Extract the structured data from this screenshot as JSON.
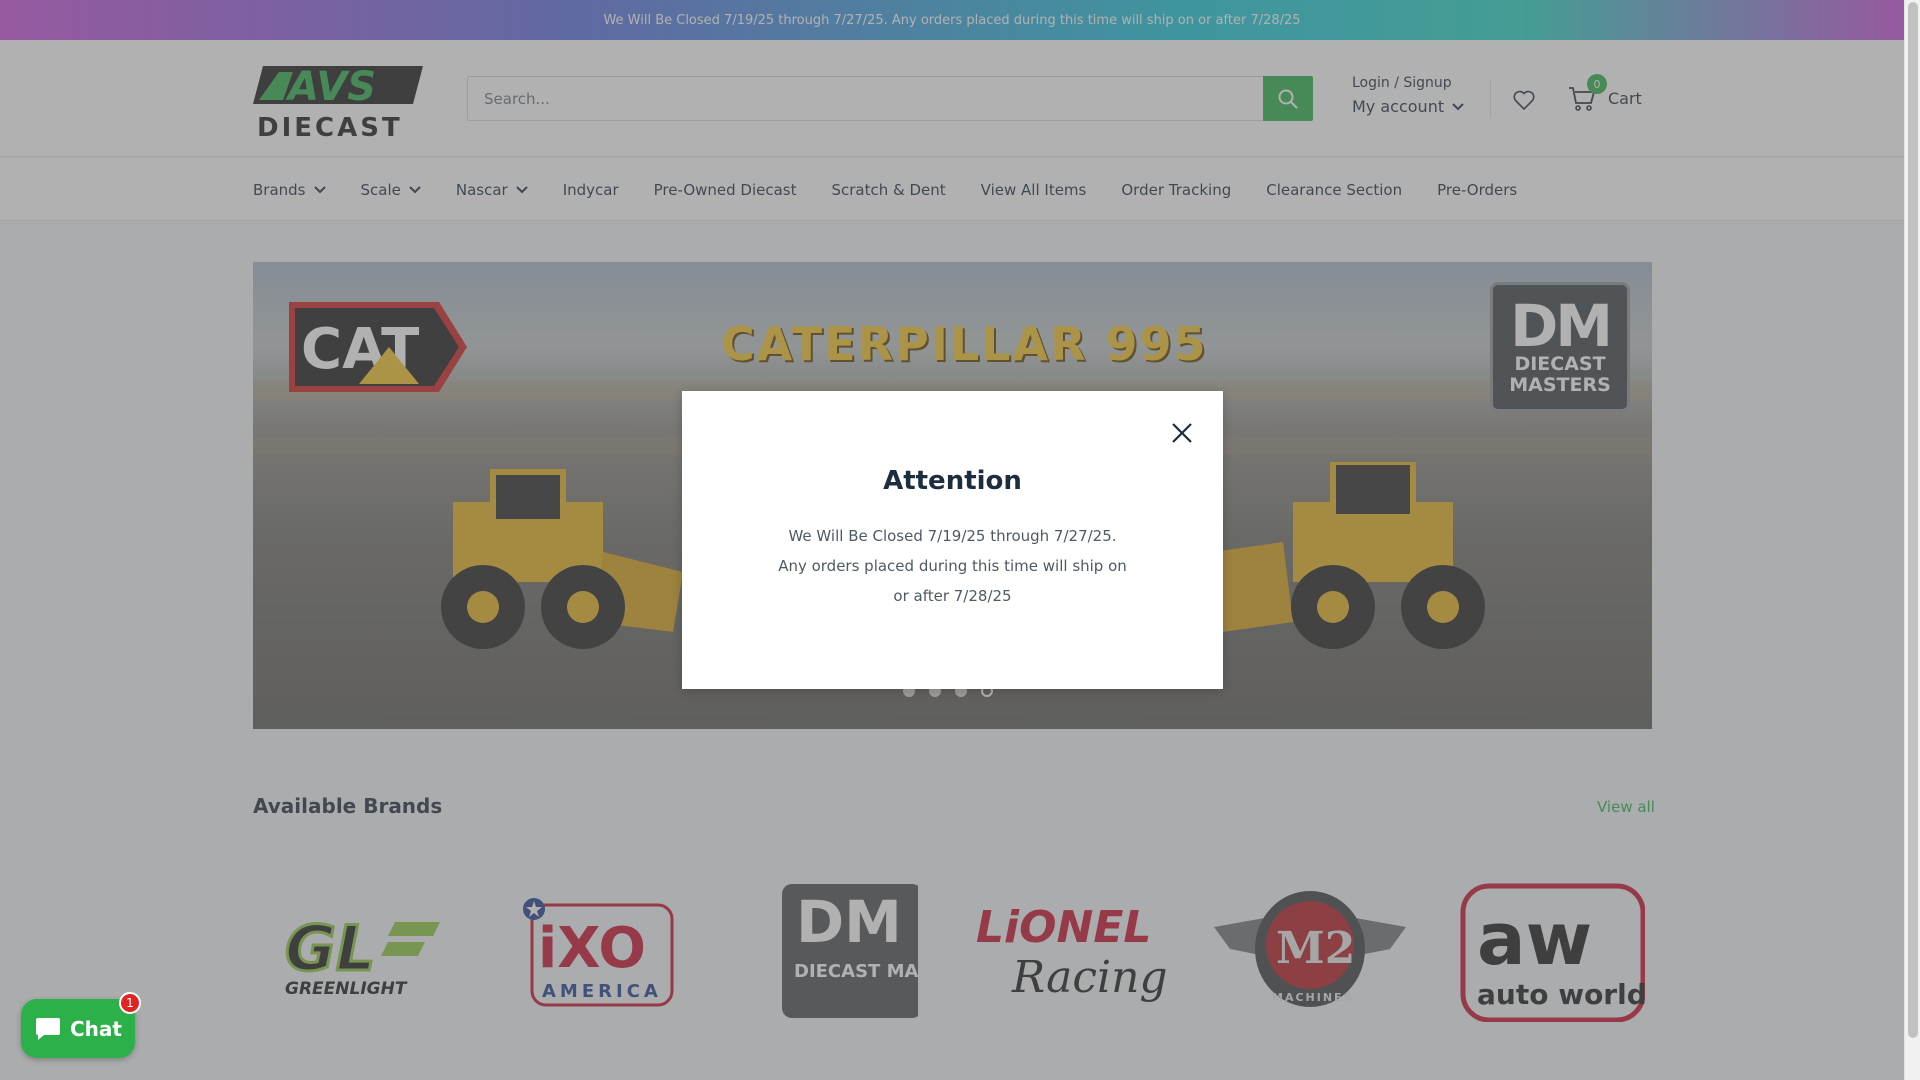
{
  "announcement": "We Will Be Closed 7/19/25 through 7/27/25. Any orders placed during this time will ship on or after 7/28/25",
  "header": {
    "logo_top": "AVS",
    "logo_bottom": "DIECAST",
    "search_placeholder": "Search...",
    "login_label": "Login / Signup",
    "account_label": "My account",
    "cart_count": "0",
    "cart_label": "Cart"
  },
  "nav": {
    "items": [
      {
        "label": "Brands",
        "dropdown": true
      },
      {
        "label": "Scale",
        "dropdown": true
      },
      {
        "label": "Nascar",
        "dropdown": true
      },
      {
        "label": "Indycar",
        "dropdown": false
      },
      {
        "label": "Pre-Owned Diecast",
        "dropdown": false
      },
      {
        "label": "Scratch & Dent",
        "dropdown": false
      },
      {
        "label": "View All Items",
        "dropdown": false
      },
      {
        "label": "Order Tracking",
        "dropdown": false
      },
      {
        "label": "Clearance Section",
        "dropdown": false
      },
      {
        "label": "Pre-Orders",
        "dropdown": false
      }
    ]
  },
  "hero": {
    "cat_logo": "CAT",
    "title": "CATERPILLAR 995",
    "dm_logo_main": "DM",
    "dm_logo_sub1": "DIECAST",
    "dm_logo_sub2": "MASTERS",
    "slide_count": 4,
    "active_slide": 4
  },
  "modal": {
    "title": "Attention",
    "message": "We Will Be Closed 7/19/25 through 7/27/25. Any orders placed during this time will ship on or after 7/28/25"
  },
  "brands": {
    "title": "Available Brands",
    "view_all": "View all",
    "items": [
      {
        "name": "GreenLight",
        "logo_text": "GREENLIGHT",
        "mark": "GL"
      },
      {
        "name": "iXO America",
        "logo_text": "AMERICA",
        "mark": "iXO"
      },
      {
        "name": "Diecast Masters",
        "logo_text": "DIECAST MASTERS",
        "mark": "DM"
      },
      {
        "name": "Lionel Racing",
        "logo_text": "Racing",
        "mark": "LiONEL"
      },
      {
        "name": "M2 Machines",
        "logo_text": "MACHINES",
        "mark": "M2"
      },
      {
        "name": "Auto World",
        "logo_text": "auto world",
        "mark": "aw"
      }
    ]
  },
  "chat": {
    "label": "Chat",
    "badge": "1"
  },
  "colors": {
    "accent_green": "#2bb04a",
    "text_dark": "#1e2d3d",
    "badge_red": "#e02424"
  }
}
